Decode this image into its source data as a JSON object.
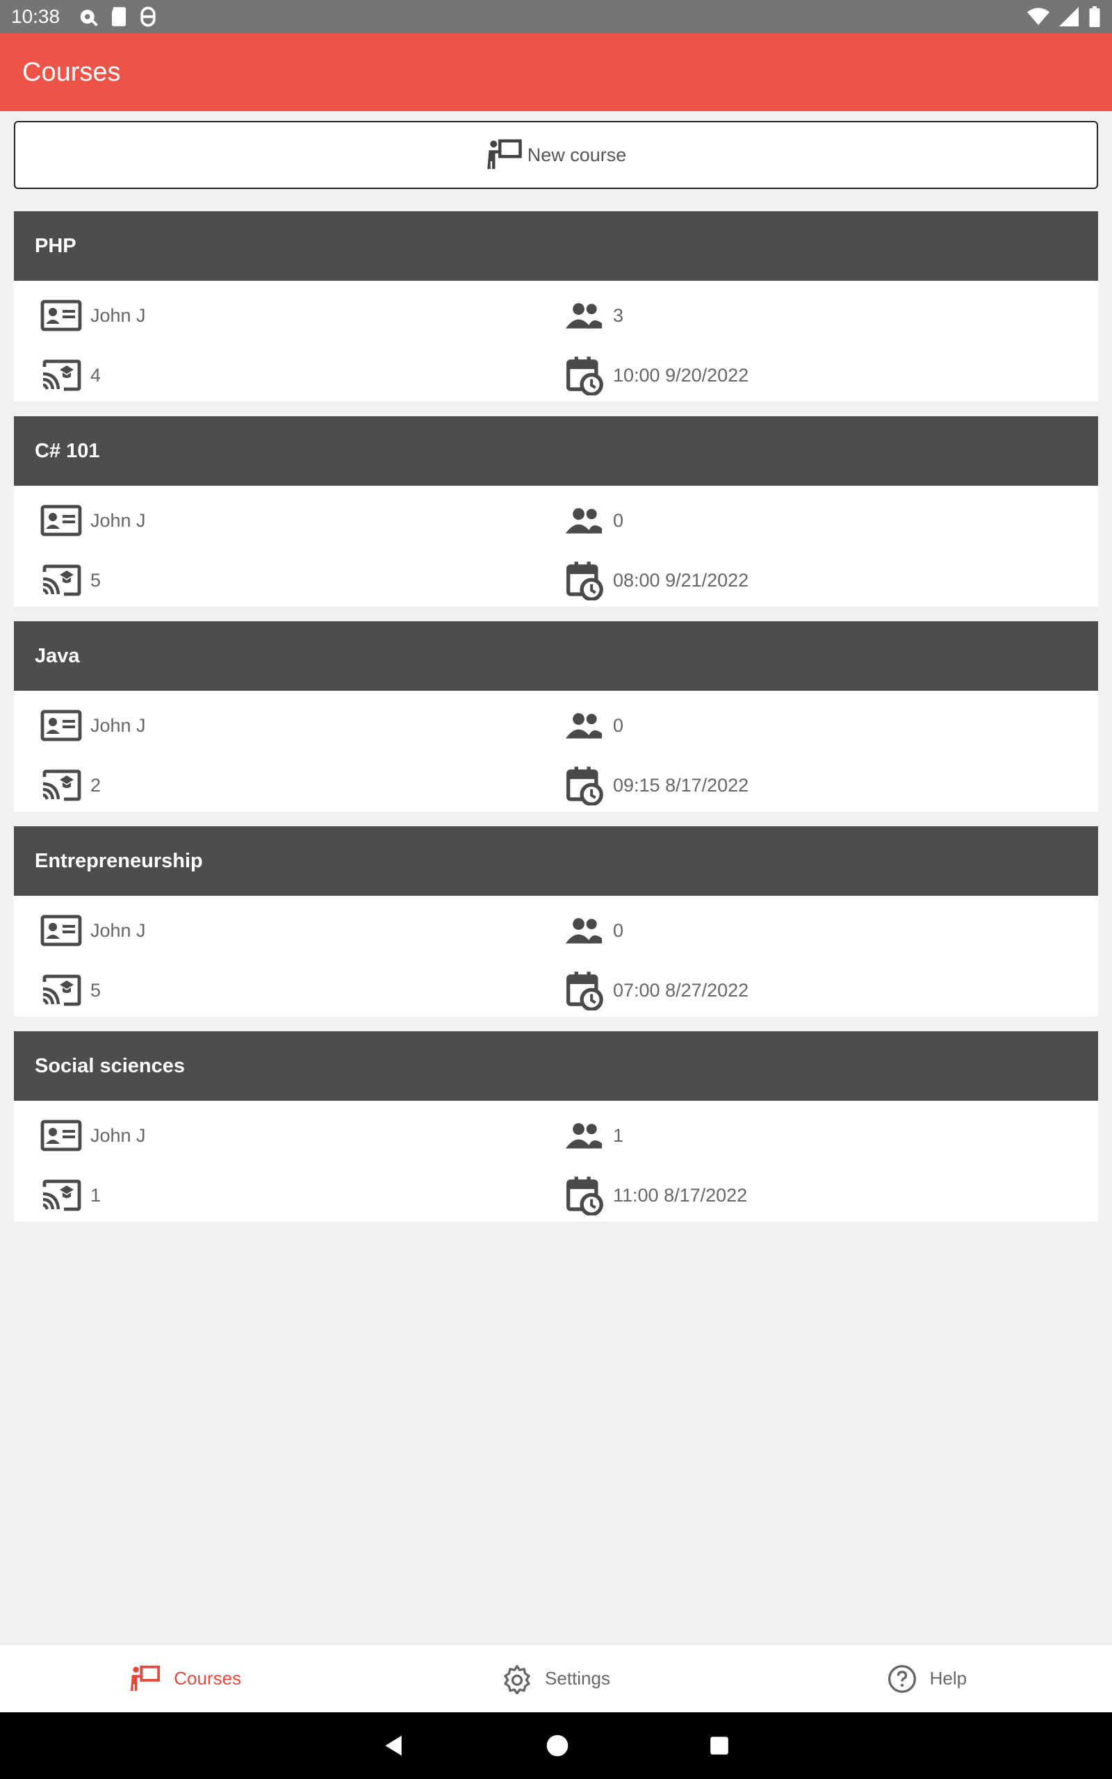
{
  "status_bar": {
    "time": "10:38"
  },
  "app_bar": {
    "title": "Courses"
  },
  "new_course_button": {
    "label": "New course"
  },
  "courses": [
    {
      "name": "PHP",
      "teacher": "John J",
      "students": "3",
      "lessons": "4",
      "schedule": "10:00 9/20/2022"
    },
    {
      "name": "C# 101",
      "teacher": "John J",
      "students": "0",
      "lessons": "5",
      "schedule": "08:00 9/21/2022"
    },
    {
      "name": "Java",
      "teacher": "John J",
      "students": "0",
      "lessons": "2",
      "schedule": "09:15 8/17/2022"
    },
    {
      "name": "Entrepreneurship",
      "teacher": "John J",
      "students": "0",
      "lessons": "5",
      "schedule": "07:00 8/27/2022"
    },
    {
      "name": "Social sciences",
      "teacher": "John J",
      "students": "1",
      "lessons": "1",
      "schedule": "11:00 8/17/2022"
    }
  ],
  "bottom_nav": {
    "items": [
      {
        "label": "Courses",
        "icon": "teacher-board-icon",
        "active": true
      },
      {
        "label": "Settings",
        "icon": "gear-icon",
        "active": false
      },
      {
        "label": "Help",
        "icon": "help-circle-icon",
        "active": false
      }
    ]
  },
  "colors": {
    "accent": "#ec5447",
    "header_dark": "#4d4d4d",
    "background": "#f1f1f1"
  }
}
